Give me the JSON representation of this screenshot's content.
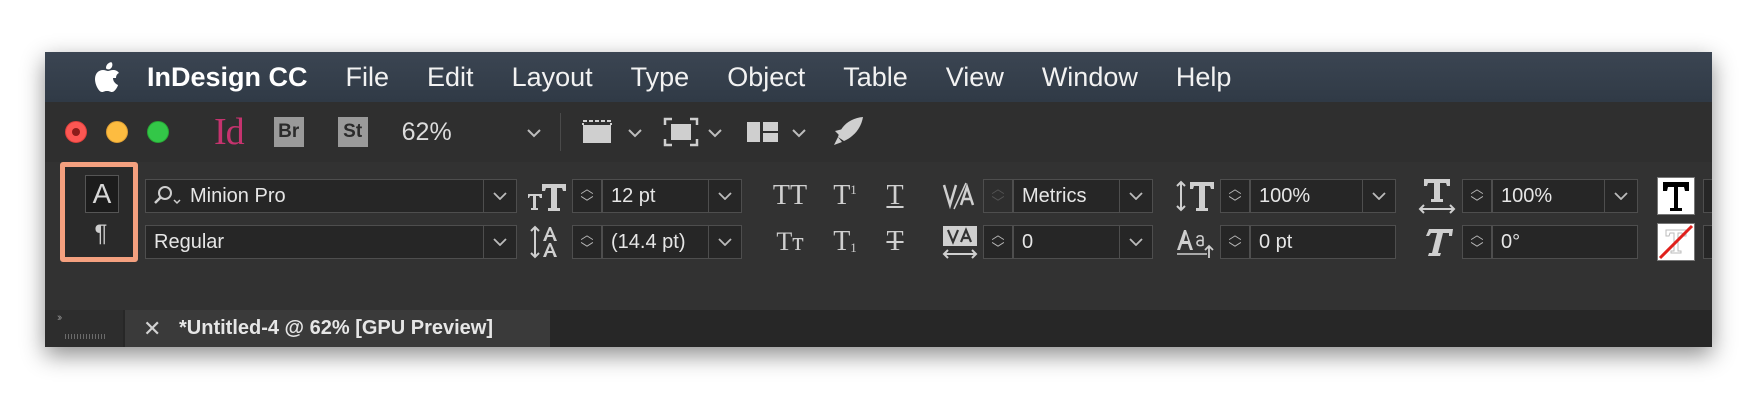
{
  "menubar": {
    "app_name": "InDesign CC",
    "items": [
      "File",
      "Edit",
      "Layout",
      "Type",
      "Object",
      "Table",
      "View",
      "Window",
      "Help"
    ]
  },
  "appbar": {
    "app_logo": "Id",
    "bridge": "Br",
    "stock": "St",
    "zoom": "62%",
    "icons": [
      "apple-icon",
      "view-options-icon",
      "screen-mode-icon",
      "arrange-documents-icon",
      "publish-online-icon"
    ]
  },
  "control": {
    "font_family": "Minion Pro",
    "font_style": "Regular",
    "font_size": "12 pt",
    "leading": "(14.4 pt)",
    "kerning": "Metrics",
    "tracking": "0",
    "vertical_scale": "100%",
    "horizontal_scale": "100%",
    "baseline_shift": "0 pt",
    "skew": "0°",
    "glyphs": {
      "all_caps": "TT",
      "small_caps": "Tт",
      "superscript": "T",
      "superscript_mark": "1",
      "subscript": "T",
      "subscript_mark": "1",
      "underline": "T",
      "strikethrough": "T",
      "char_mode": "A",
      "para_mode": "¶"
    }
  },
  "document_tab": {
    "close": "✕",
    "title": "*Untitled-4 @ 62% [GPU Preview]"
  },
  "colors": {
    "highlight": "#f4a07f",
    "indesign_brand": "#c5336e"
  }
}
